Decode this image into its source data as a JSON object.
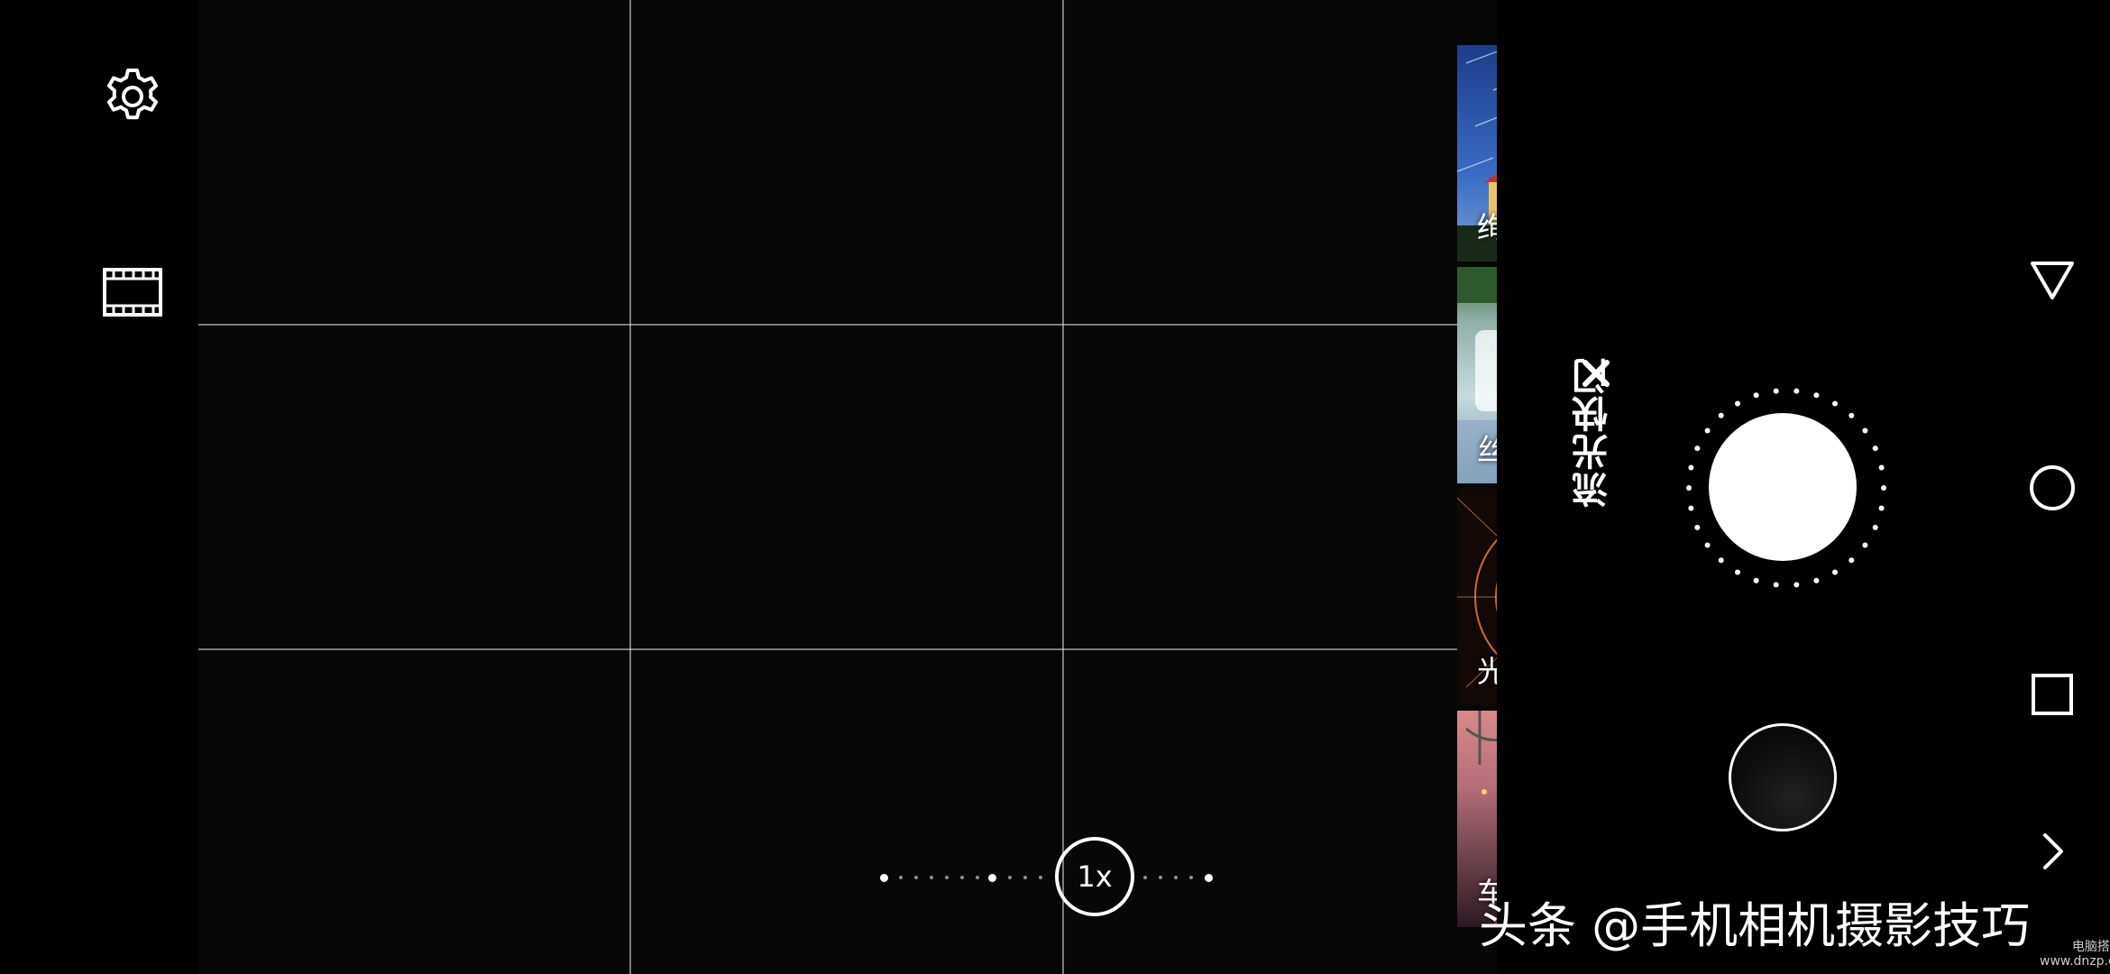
{
  "left_bar": {
    "settings_icon": "gear-icon",
    "video_icon": "film-strip-icon"
  },
  "zoom": {
    "level_label": "1x"
  },
  "modes": [
    {
      "label": "绚丽星轨",
      "selected": false
    },
    {
      "label": "丝绢流水",
      "selected": false
    },
    {
      "label": "光绘涂鸦",
      "selected": false
    },
    {
      "label": "车水马龙",
      "selected": true
    }
  ],
  "right_panel": {
    "mode_title": "流光快门",
    "close_icon": "close-icon"
  },
  "nav": {
    "back_icon": "triangle-back-icon",
    "home_icon": "circle-home-icon",
    "recents_icon": "square-recents-icon",
    "expand_icon": "chevron-right-icon"
  },
  "watermark": {
    "text": "头条 @手机相机摄影技巧",
    "small_line1": "电脑搭配网",
    "small_line2": "www.dnzp.com"
  }
}
